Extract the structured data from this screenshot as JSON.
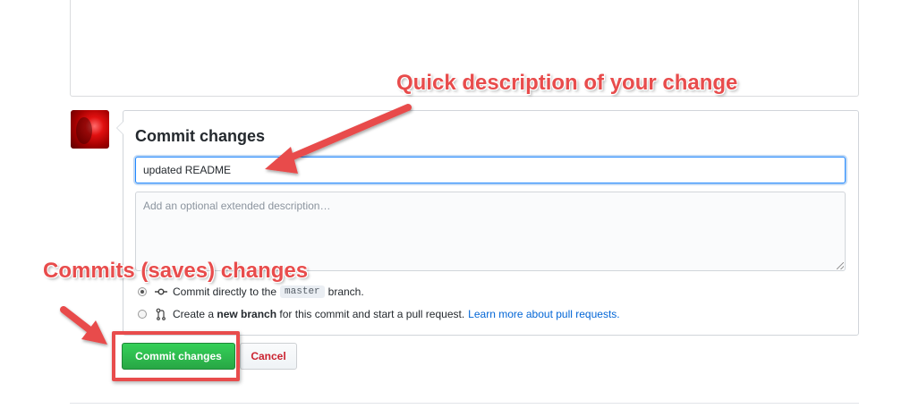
{
  "commit_form": {
    "title": "Commit changes",
    "summary_value": "updated README",
    "description_placeholder": "Add an optional extended description…",
    "option_direct": {
      "prefix": "Commit directly to the",
      "branch": "master",
      "suffix": "branch.",
      "selected": true
    },
    "option_new_branch": {
      "prefix": "Create a",
      "bold": "new branch",
      "suffix": "for this commit and start a pull request.",
      "link": "Learn more about pull requests.",
      "selected": false
    },
    "commit_button": "Commit changes",
    "cancel_button": "Cancel"
  },
  "annotations": {
    "summary_callout": "Quick description of your change",
    "commit_callout": "Commits (saves) changes",
    "color": "#e84c4c"
  },
  "colors": {
    "commit_button": "#28a745",
    "cancel_text": "#cb2431",
    "link": "#0366d6"
  },
  "icons": {
    "direct_commit": "git-commit-icon",
    "new_branch": "git-pull-request-icon"
  }
}
